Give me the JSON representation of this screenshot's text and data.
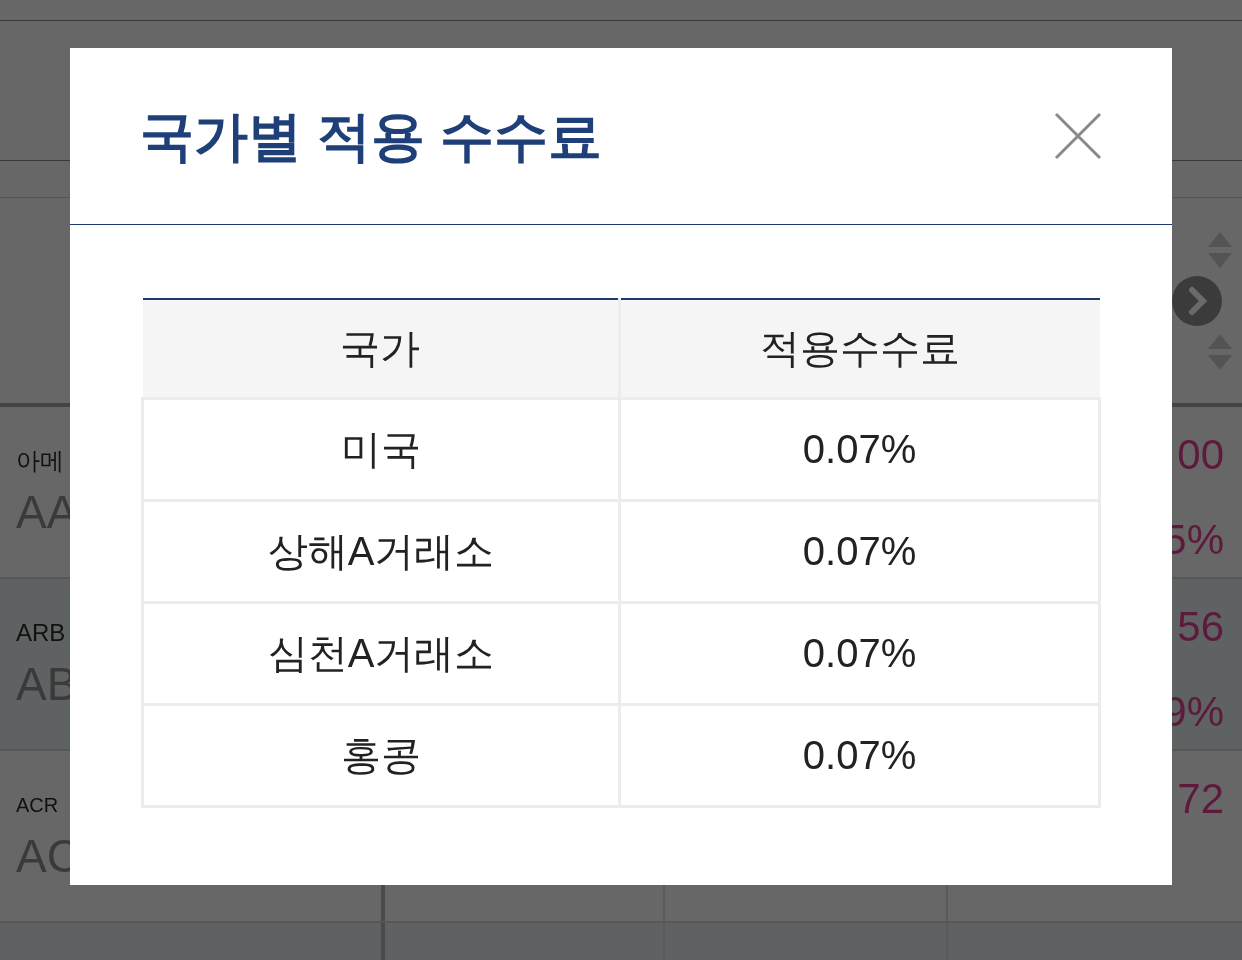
{
  "background": {
    "rows": [
      {
        "name": "아메",
        "code": "AA",
        "value_1": "00",
        "value_2": "5%"
      },
      {
        "name": "ARB",
        "code": "AB",
        "value_1": "56",
        "value_2": "9%"
      },
      {
        "name": "ACR",
        "code": "AC",
        "value_1": "72"
      }
    ]
  },
  "modal": {
    "title": "국가별 적용 수수료",
    "columns": [
      "국가",
      "적용수수료"
    ],
    "rows": [
      [
        "미국",
        "0.07%"
      ],
      [
        "상해A거래소",
        "0.07%"
      ],
      [
        "심천A거래소",
        "0.07%"
      ],
      [
        "홍콩",
        "0.07%"
      ]
    ]
  }
}
